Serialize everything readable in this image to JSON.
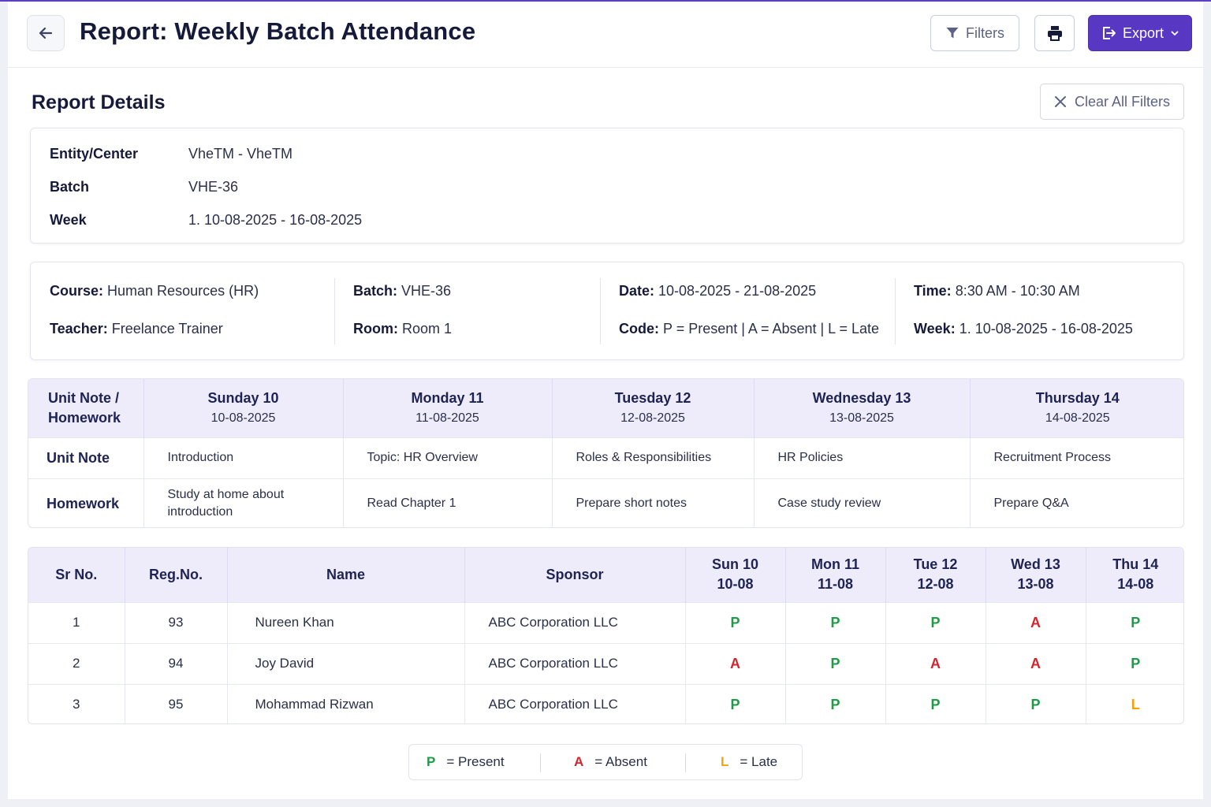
{
  "header": {
    "title": "Report: Weekly Batch Attendance",
    "filters_label": "Filters",
    "export_label": "Export"
  },
  "details_section": {
    "title": "Report Details",
    "clear_label": "Clear All Filters",
    "rows": [
      {
        "label": "Entity/Center",
        "value": "VheTM - VheTM"
      },
      {
        "label": "Batch",
        "value": "VHE-36"
      },
      {
        "label": "Week",
        "value": "1. 10-08-2025 - 16-08-2025"
      }
    ]
  },
  "info": {
    "course_label": "Course:",
    "course": "Human Resources (HR)",
    "teacher_label": "Teacher:",
    "teacher": "Freelance Trainer",
    "batch_label": "Batch:",
    "batch": "VHE-36",
    "room_label": "Room:",
    "room": "Room 1",
    "date_label": "Date:",
    "date": "10-08-2025 - 21-08-2025",
    "code_label": "Code:",
    "code": "P = Present | A = Absent | L = Late",
    "time_label": "Time:",
    "time": "8:30 AM - 10:30 AM",
    "week_label": "Week:",
    "week": "1. 10-08-2025 - 16-08-2025"
  },
  "unit_table": {
    "corner_header": "Unit Note / Homework",
    "days": [
      {
        "day": "Sunday 10",
        "date": "10-08-2025"
      },
      {
        "day": "Monday 11",
        "date": "11-08-2025"
      },
      {
        "day": "Tuesday 12",
        "date": "12-08-2025"
      },
      {
        "day": "Wednesday 13",
        "date": "13-08-2025"
      },
      {
        "day": "Thursday 14",
        "date": "14-08-2025"
      }
    ],
    "unit_note_label": "Unit Note",
    "unit_notes": [
      "Introduction",
      "Topic: HR Overview",
      "Roles & Responsibilities",
      "HR Policies",
      "Recruitment Process"
    ],
    "homework_label": "Homework",
    "homework": [
      "Study at home about introduction",
      "Read Chapter 1",
      "Prepare short notes",
      "Case study review",
      "Prepare Q&A"
    ]
  },
  "attendance_table": {
    "headers": {
      "sr": "Sr No.",
      "reg": "Reg.No.",
      "name": "Name",
      "sponsor": "Sponsor"
    },
    "day_headers": [
      {
        "day": "Sun 10",
        "date": "10-08"
      },
      {
        "day": "Mon 11",
        "date": "11-08"
      },
      {
        "day": "Tue 12",
        "date": "12-08"
      },
      {
        "day": "Wed 13",
        "date": "13-08"
      },
      {
        "day": "Thu 14",
        "date": "14-08"
      }
    ],
    "rows": [
      {
        "sr": "1",
        "reg": "93",
        "name": "Nureen Khan",
        "sponsor": "ABC Corporation LLC",
        "marks": [
          "P",
          "P",
          "P",
          "A",
          "P"
        ]
      },
      {
        "sr": "2",
        "reg": "94",
        "name": "Joy David",
        "sponsor": "ABC Corporation LLC",
        "marks": [
          "A",
          "P",
          "A",
          "A",
          "P"
        ]
      },
      {
        "sr": "3",
        "reg": "95",
        "name": "Mohammad Rizwan",
        "sponsor": "ABC Corporation LLC",
        "marks": [
          "P",
          "P",
          "P",
          "P",
          "L"
        ]
      }
    ]
  },
  "legend": [
    {
      "code": "P",
      "text": "= Present"
    },
    {
      "code": "A",
      "text": "= Absent"
    },
    {
      "code": "L",
      "text": "= Late"
    }
  ],
  "colors": {
    "accent": "#5838c2",
    "present": "#1f9a47",
    "absent": "#d6242c",
    "late": "#f2a20e",
    "header_bg": "#eeecfb"
  },
  "icons": {
    "back": "arrow-left-icon",
    "filter": "filter-icon",
    "print": "printer-icon",
    "export": "export-icon",
    "dropdown": "chevron-down-icon",
    "clear": "close-icon"
  }
}
